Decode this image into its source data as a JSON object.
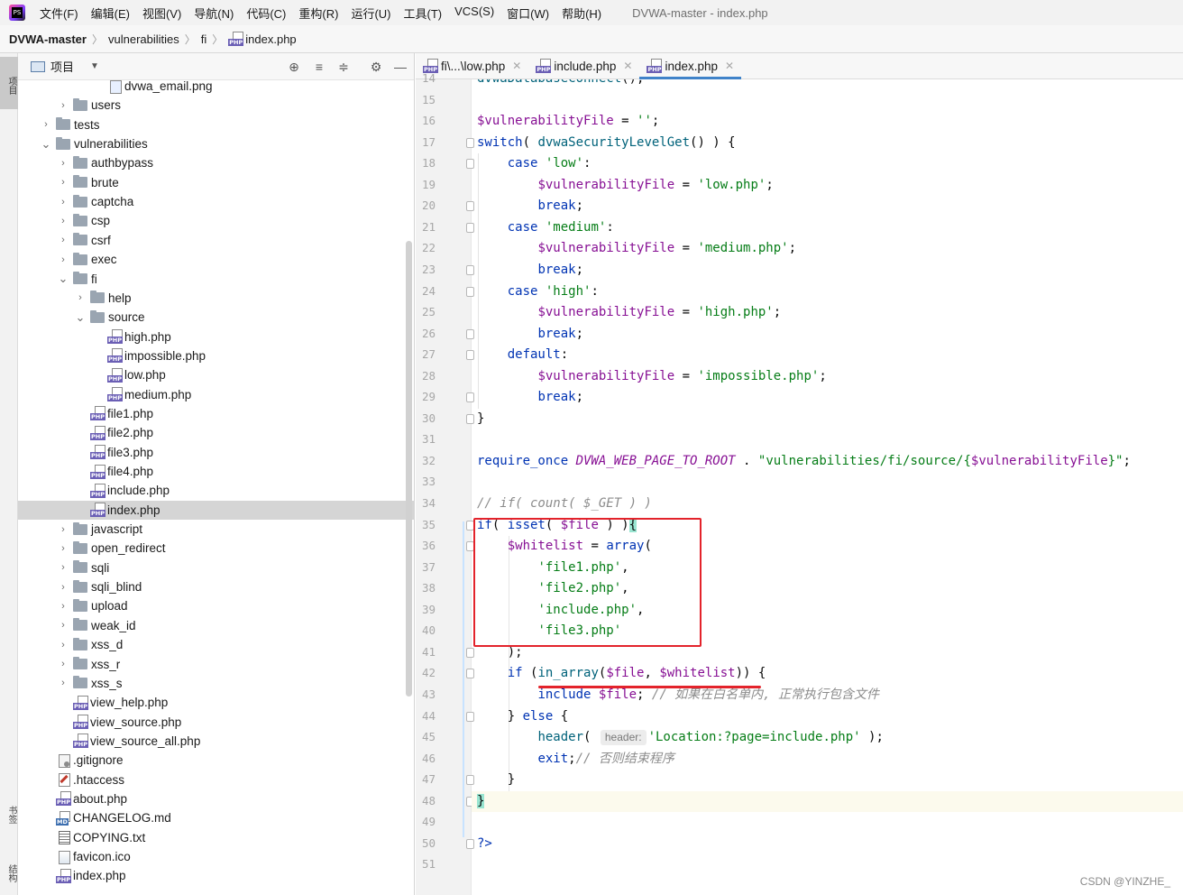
{
  "menu": {
    "items": [
      "文件(F)",
      "编辑(E)",
      "视图(V)",
      "导航(N)",
      "代码(C)",
      "重构(R)",
      "运行(U)",
      "工具(T)",
      "VCS(S)",
      "窗口(W)",
      "帮助(H)"
    ],
    "window_title": "DVWA-master - index.php"
  },
  "breadcrumb": {
    "items": [
      "DVWA-master",
      "vulnerabilities",
      "fi",
      "index.php"
    ]
  },
  "side_stripe": {
    "project": "项目",
    "bookmarks": "书签",
    "structure": "结构"
  },
  "project_panel": {
    "title": "项目",
    "tree": [
      {
        "label": "dvwa_email.png",
        "icon": "png",
        "depth": 4,
        "chevron": ""
      },
      {
        "label": "users",
        "icon": "folder",
        "depth": 2,
        "chevron": "›"
      },
      {
        "label": "tests",
        "icon": "folder",
        "depth": 1,
        "chevron": "›"
      },
      {
        "label": "vulnerabilities",
        "icon": "folder",
        "depth": 1,
        "chevron": "⌄"
      },
      {
        "label": "authbypass",
        "icon": "folder",
        "depth": 2,
        "chevron": "›"
      },
      {
        "label": "brute",
        "icon": "folder",
        "depth": 2,
        "chevron": "›"
      },
      {
        "label": "captcha",
        "icon": "folder",
        "depth": 2,
        "chevron": "›"
      },
      {
        "label": "csp",
        "icon": "folder",
        "depth": 2,
        "chevron": "›"
      },
      {
        "label": "csrf",
        "icon": "folder",
        "depth": 2,
        "chevron": "›"
      },
      {
        "label": "exec",
        "icon": "folder",
        "depth": 2,
        "chevron": "›"
      },
      {
        "label": "fi",
        "icon": "folder",
        "depth": 2,
        "chevron": "⌄"
      },
      {
        "label": "help",
        "icon": "folder",
        "depth": 3,
        "chevron": "›"
      },
      {
        "label": "source",
        "icon": "folder",
        "depth": 3,
        "chevron": "⌄"
      },
      {
        "label": "high.php",
        "icon": "php",
        "depth": 4,
        "chevron": ""
      },
      {
        "label": "impossible.php",
        "icon": "php",
        "depth": 4,
        "chevron": ""
      },
      {
        "label": "low.php",
        "icon": "php",
        "depth": 4,
        "chevron": ""
      },
      {
        "label": "medium.php",
        "icon": "php",
        "depth": 4,
        "chevron": ""
      },
      {
        "label": "file1.php",
        "icon": "php",
        "depth": 3,
        "chevron": ""
      },
      {
        "label": "file2.php",
        "icon": "php",
        "depth": 3,
        "chevron": ""
      },
      {
        "label": "file3.php",
        "icon": "php",
        "depth": 3,
        "chevron": ""
      },
      {
        "label": "file4.php",
        "icon": "php",
        "depth": 3,
        "chevron": ""
      },
      {
        "label": "include.php",
        "icon": "php",
        "depth": 3,
        "chevron": ""
      },
      {
        "label": "index.php",
        "icon": "php",
        "depth": 3,
        "chevron": "",
        "selected": true
      },
      {
        "label": "javascript",
        "icon": "folder",
        "depth": 2,
        "chevron": "›"
      },
      {
        "label": "open_redirect",
        "icon": "folder",
        "depth": 2,
        "chevron": "›"
      },
      {
        "label": "sqli",
        "icon": "folder",
        "depth": 2,
        "chevron": "›"
      },
      {
        "label": "sqli_blind",
        "icon": "folder",
        "depth": 2,
        "chevron": "›"
      },
      {
        "label": "upload",
        "icon": "folder",
        "depth": 2,
        "chevron": "›"
      },
      {
        "label": "weak_id",
        "icon": "folder",
        "depth": 2,
        "chevron": "›"
      },
      {
        "label": "xss_d",
        "icon": "folder",
        "depth": 2,
        "chevron": "›"
      },
      {
        "label": "xss_r",
        "icon": "folder",
        "depth": 2,
        "chevron": "›"
      },
      {
        "label": "xss_s",
        "icon": "folder",
        "depth": 2,
        "chevron": "›"
      },
      {
        "label": "view_help.php",
        "icon": "php",
        "depth": 2,
        "chevron": ""
      },
      {
        "label": "view_source.php",
        "icon": "php",
        "depth": 2,
        "chevron": ""
      },
      {
        "label": "view_source_all.php",
        "icon": "php",
        "depth": 2,
        "chevron": ""
      },
      {
        "label": ".gitignore",
        "icon": "git",
        "depth": 1,
        "chevron": ""
      },
      {
        "label": ".htaccess",
        "icon": "ht",
        "depth": 1,
        "chevron": ""
      },
      {
        "label": "about.php",
        "icon": "php",
        "depth": 1,
        "chevron": ""
      },
      {
        "label": "CHANGELOG.md",
        "icon": "md",
        "depth": 1,
        "chevron": ""
      },
      {
        "label": "COPYING.txt",
        "icon": "txt",
        "depth": 1,
        "chevron": ""
      },
      {
        "label": "favicon.ico",
        "icon": "ico",
        "depth": 1,
        "chevron": ""
      },
      {
        "label": "index.php",
        "icon": "php",
        "depth": 1,
        "chevron": ""
      }
    ]
  },
  "editor": {
    "tabs": [
      {
        "label": "fi\\...\\low.php",
        "active": false
      },
      {
        "label": "include.php",
        "active": false
      },
      {
        "label": "index.php",
        "active": true
      }
    ],
    "current_line": 48,
    "lines": [
      {
        "n": 14,
        "t": [
          [
            "fn",
            "dvwaDatabaseConnect"
          ],
          [
            "plain",
            "();"
          ]
        ]
      },
      {
        "n": 15,
        "t": []
      },
      {
        "n": 16,
        "t": [
          [
            "var",
            "$vulnerabilityFile"
          ],
          [
            "plain",
            " = "
          ],
          [
            "str",
            "''"
          ],
          [
            "plain",
            ";"
          ]
        ]
      },
      {
        "n": 17,
        "t": [
          [
            "kw",
            "switch"
          ],
          [
            "plain",
            "( "
          ],
          [
            "fn",
            "dvwaSecurityLevelGet"
          ],
          [
            "plain",
            "() ) {"
          ]
        ]
      },
      {
        "n": 18,
        "t": [
          [
            "plain",
            "    "
          ],
          [
            "kw",
            "case "
          ],
          [
            "str",
            "'low'"
          ],
          [
            "plain",
            ":"
          ]
        ]
      },
      {
        "n": 19,
        "t": [
          [
            "plain",
            "        "
          ],
          [
            "var",
            "$vulnerabilityFile"
          ],
          [
            "plain",
            " = "
          ],
          [
            "str",
            "'low.php'"
          ],
          [
            "plain",
            ";"
          ]
        ]
      },
      {
        "n": 20,
        "t": [
          [
            "plain",
            "        "
          ],
          [
            "kw",
            "break"
          ],
          [
            "plain",
            ";"
          ]
        ]
      },
      {
        "n": 21,
        "t": [
          [
            "plain",
            "    "
          ],
          [
            "kw",
            "case "
          ],
          [
            "str",
            "'medium'"
          ],
          [
            "plain",
            ":"
          ]
        ]
      },
      {
        "n": 22,
        "t": [
          [
            "plain",
            "        "
          ],
          [
            "var",
            "$vulnerabilityFile"
          ],
          [
            "plain",
            " = "
          ],
          [
            "str",
            "'medium.php'"
          ],
          [
            "plain",
            ";"
          ]
        ]
      },
      {
        "n": 23,
        "t": [
          [
            "plain",
            "        "
          ],
          [
            "kw",
            "break"
          ],
          [
            "plain",
            ";"
          ]
        ]
      },
      {
        "n": 24,
        "t": [
          [
            "plain",
            "    "
          ],
          [
            "kw",
            "case "
          ],
          [
            "str",
            "'high'"
          ],
          [
            "plain",
            ":"
          ]
        ]
      },
      {
        "n": 25,
        "t": [
          [
            "plain",
            "        "
          ],
          [
            "var",
            "$vulnerabilityFile"
          ],
          [
            "plain",
            " = "
          ],
          [
            "str",
            "'high.php'"
          ],
          [
            "plain",
            ";"
          ]
        ]
      },
      {
        "n": 26,
        "t": [
          [
            "plain",
            "        "
          ],
          [
            "kw",
            "break"
          ],
          [
            "plain",
            ";"
          ]
        ]
      },
      {
        "n": 27,
        "t": [
          [
            "plain",
            "    "
          ],
          [
            "kw",
            "default"
          ],
          [
            "plain",
            ":"
          ]
        ]
      },
      {
        "n": 28,
        "t": [
          [
            "plain",
            "        "
          ],
          [
            "var",
            "$vulnerabilityFile"
          ],
          [
            "plain",
            " = "
          ],
          [
            "str",
            "'impossible.php'"
          ],
          [
            "plain",
            ";"
          ]
        ]
      },
      {
        "n": 29,
        "t": [
          [
            "plain",
            "        "
          ],
          [
            "kw",
            "break"
          ],
          [
            "plain",
            ";"
          ]
        ]
      },
      {
        "n": 30,
        "t": [
          [
            "plain",
            "}"
          ]
        ]
      },
      {
        "n": 31,
        "t": []
      },
      {
        "n": 32,
        "t": [
          [
            "kw",
            "require_once "
          ],
          [
            "cst",
            "DVWA_WEB_PAGE_TO_ROOT"
          ],
          [
            "plain",
            " . "
          ],
          [
            "str",
            "\"vulnerabilities/fi/source/{"
          ],
          [
            "var",
            "$vulnerabilityFile"
          ],
          [
            "str",
            "}\""
          ],
          [
            "plain",
            ";"
          ]
        ]
      },
      {
        "n": 33,
        "t": []
      },
      {
        "n": 34,
        "t": [
          [
            "com",
            "// if( count( $_GET ) )"
          ]
        ]
      },
      {
        "n": 35,
        "t": [
          [
            "kw",
            "if"
          ],
          [
            "plain",
            "( "
          ],
          [
            "kw",
            "isset"
          ],
          [
            "plain",
            "( "
          ],
          [
            "var",
            "$file"
          ],
          [
            "plain",
            " ) )"
          ],
          [
            "brace",
            "{"
          ]
        ]
      },
      {
        "n": 36,
        "t": [
          [
            "plain",
            "    "
          ],
          [
            "var",
            "$whitelist"
          ],
          [
            "plain",
            " = "
          ],
          [
            "kw",
            "array"
          ],
          [
            "plain",
            "("
          ]
        ]
      },
      {
        "n": 37,
        "t": [
          [
            "plain",
            "        "
          ],
          [
            "str",
            "'file1.php'"
          ],
          [
            "plain",
            ","
          ]
        ]
      },
      {
        "n": 38,
        "t": [
          [
            "plain",
            "        "
          ],
          [
            "str",
            "'file2.php'"
          ],
          [
            "plain",
            ","
          ]
        ]
      },
      {
        "n": 39,
        "t": [
          [
            "plain",
            "        "
          ],
          [
            "str",
            "'include.php'"
          ],
          [
            "plain",
            ","
          ]
        ]
      },
      {
        "n": 40,
        "t": [
          [
            "plain",
            "        "
          ],
          [
            "str",
            "'file3.php'"
          ]
        ]
      },
      {
        "n": 41,
        "t": [
          [
            "plain",
            "    );"
          ]
        ]
      },
      {
        "n": 42,
        "t": [
          [
            "plain",
            "    "
          ],
          [
            "kw",
            "if"
          ],
          [
            "plain",
            " ("
          ],
          [
            "fn",
            "in_array"
          ],
          [
            "plain",
            "("
          ],
          [
            "var",
            "$file"
          ],
          [
            "plain",
            ", "
          ],
          [
            "var",
            "$whitelist"
          ],
          [
            "plain",
            ")) {"
          ]
        ]
      },
      {
        "n": 43,
        "t": [
          [
            "plain",
            "        "
          ],
          [
            "kw",
            "include "
          ],
          [
            "var",
            "$file"
          ],
          [
            "plain",
            "; "
          ],
          [
            "com",
            "// 如果在白名单内, 正常执行包含文件"
          ]
        ]
      },
      {
        "n": 44,
        "t": [
          [
            "plain",
            "    } "
          ],
          [
            "kw",
            "else"
          ],
          [
            "plain",
            " {"
          ]
        ]
      },
      {
        "n": 45,
        "t": [
          [
            "plain",
            "        "
          ],
          [
            "fn",
            "header"
          ],
          [
            "plain",
            "( "
          ],
          [
            "hint",
            "header:"
          ],
          [
            "str",
            "'Location:?page=include.php'"
          ],
          [
            "plain",
            " );"
          ]
        ]
      },
      {
        "n": 46,
        "t": [
          [
            "plain",
            "        "
          ],
          [
            "kw",
            "exit"
          ],
          [
            "plain",
            ";"
          ],
          [
            "com",
            "// 否则结束程序"
          ]
        ]
      },
      {
        "n": 47,
        "t": [
          [
            "plain",
            "    }"
          ]
        ]
      },
      {
        "n": 48,
        "t": [
          [
            "brace",
            "}"
          ]
        ]
      },
      {
        "n": 49,
        "t": []
      },
      {
        "n": 50,
        "t": [
          [
            "kw",
            "?>"
          ]
        ]
      },
      {
        "n": 51,
        "t": []
      }
    ]
  },
  "annotations": {
    "box_color": "#e3232b"
  },
  "watermark": "CSDN @YINZHE_"
}
